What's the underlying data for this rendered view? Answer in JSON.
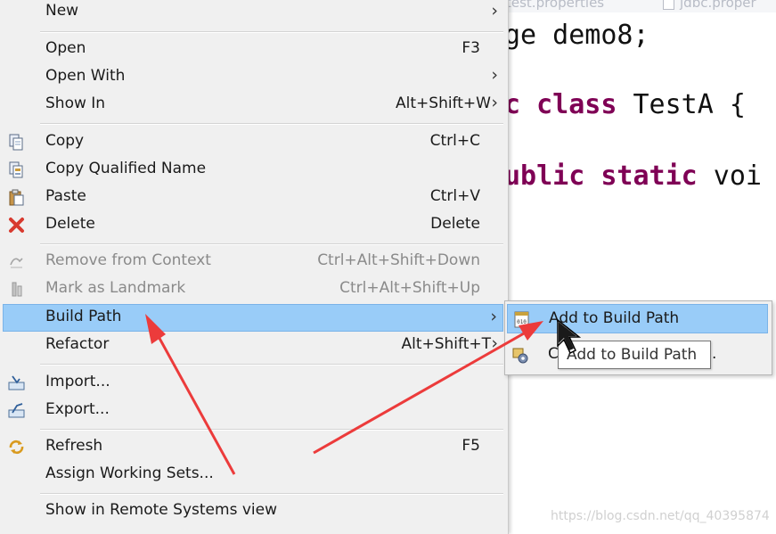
{
  "editor": {
    "tabs": [
      "test.properties",
      "jdbc.proper"
    ],
    "lines": {
      "line1": "ge demo8;",
      "line2_kw": "c class",
      "line2_rest": " TestA {",
      "line3_kw": "ublic static",
      "line3_rest": " voi"
    }
  },
  "menu": {
    "new": {
      "label": "New"
    },
    "open": {
      "label": "Open",
      "shortcut": "F3"
    },
    "open_with": {
      "label": "Open With"
    },
    "show_in": {
      "label": "Show In",
      "shortcut": "Alt+Shift+W"
    },
    "copy": {
      "label": "Copy",
      "shortcut": "Ctrl+C",
      "icon": "copy-icon"
    },
    "copy_qualified": {
      "label": "Copy Qualified Name",
      "icon": "copy-qualified-icon"
    },
    "paste": {
      "label": "Paste",
      "shortcut": "Ctrl+V",
      "icon": "paste-icon"
    },
    "delete": {
      "label": "Delete",
      "shortcut": "Delete",
      "icon": "delete-icon"
    },
    "remove_context": {
      "label": "Remove from Context",
      "shortcut": "Ctrl+Alt+Shift+Down",
      "icon": "remove-context-icon"
    },
    "mark_landmark": {
      "label": "Mark as Landmark",
      "shortcut": "Ctrl+Alt+Shift+Up",
      "icon": "landmark-icon"
    },
    "build_path": {
      "label": "Build Path"
    },
    "refactor": {
      "label": "Refactor",
      "shortcut": "Alt+Shift+T"
    },
    "import": {
      "label": "Import...",
      "icon": "import-icon"
    },
    "export": {
      "label": "Export...",
      "icon": "export-icon"
    },
    "refresh": {
      "label": "Refresh",
      "shortcut": "F5",
      "icon": "refresh-icon"
    },
    "assign_sets": {
      "label": "Assign Working Sets..."
    },
    "show_remote": {
      "label": "Show in Remote Systems view"
    }
  },
  "submenu": {
    "add_to_build_path": {
      "label": "Add to Build Path",
      "icon": "jar-icon"
    },
    "configure": {
      "label": "C",
      "suffix": ".",
      "icon": "configure-build-path-icon"
    }
  },
  "tooltip": {
    "text": "Add to Build Path"
  },
  "watermark": "https://blog.csdn.net/qq_40395874",
  "colors": {
    "highlight": "#99ccf8",
    "menu_bg": "#f0f0f0",
    "keyword": "#7f0055",
    "arrow": "#ec3b3b"
  }
}
